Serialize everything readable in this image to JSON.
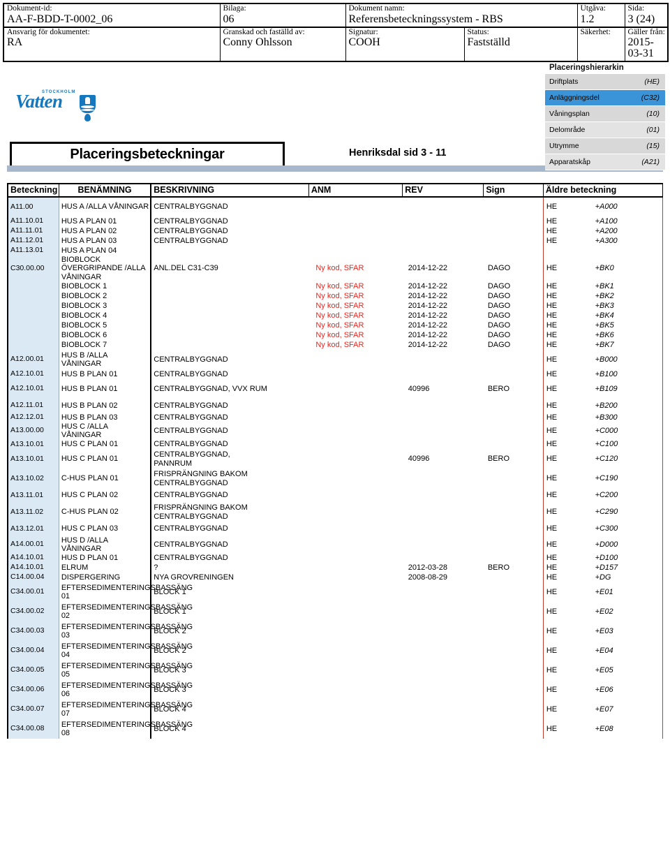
{
  "doc_header": {
    "fields": [
      {
        "label": "Dokument-id:",
        "value": "AA-F-BDD-T-0002_06"
      },
      {
        "label": "Bilaga:",
        "value": "06"
      },
      {
        "label": "Dokument namn:",
        "value": "Referensbeteckningssystem - RBS"
      },
      {
        "label": "Utgåva:",
        "value": "1.2"
      },
      {
        "label": "Sida:",
        "value": "3 (24)"
      },
      {
        "label": "Ansvarig för dokumentet:",
        "value": "RA"
      },
      {
        "label": "Granskad och faställd av:",
        "value": "Conny Ohlsson"
      },
      {
        "label": "Signatur:",
        "value": "COOH"
      },
      {
        "label": "Status:",
        "value": "Fastställd"
      },
      {
        "label": "Säkerhet:",
        "value": ""
      },
      {
        "label": "Gäller från:",
        "value": "2015-03-31"
      }
    ]
  },
  "logo": {
    "top_text": "STOCKHOLM",
    "main_text": "Vatten",
    "brand_color": "#1577bd"
  },
  "title": {
    "box_label": "Placeringsbeteckningar",
    "subtitle": "Henriksdal sid 3 - 11"
  },
  "hierarchy": {
    "title": "Placeringshierarkin",
    "selected_color": "#3c94d8",
    "rows": [
      {
        "name": "Driftplats",
        "code": "(HE)",
        "selected": false
      },
      {
        "name": "Anläggningsdel",
        "code": "(C32)",
        "selected": true
      },
      {
        "name": "Våningsplan",
        "code": "(10)",
        "selected": false
      },
      {
        "name": "Delområde",
        "code": "(01)",
        "selected": false
      },
      {
        "name": "Utrymme",
        "code": "(15)",
        "selected": false
      },
      {
        "name": "Apparatskåp",
        "code": "(A21)",
        "selected": false
      }
    ]
  },
  "table": {
    "accent_color": "#c0392b",
    "beteckning_bg": "#dbe9f4",
    "columns": [
      "Beteckning",
      "BENÄMNING",
      "BESKRIVNING",
      "ANM",
      "REV",
      "Sign",
      "Äldre beteckning"
    ],
    "rows": [
      {
        "bet": "A11.00",
        "ben": "HUS A  /ALLA VÅNINGAR",
        "besk": "CENTRALBYGGNAD",
        "anm": "",
        "rev": "",
        "sign": "",
        "he": "HE",
        "old": "+A000",
        "h": "tall"
      },
      {
        "bet": "A11.10.01",
        "ben": "HUS A PLAN 01",
        "besk": "CENTRALBYGGNAD",
        "anm": "",
        "rev": "",
        "sign": "",
        "he": "HE",
        "old": "+A100",
        "h": ""
      },
      {
        "bet": "A11.11.01",
        "ben": "HUS A PLAN 02",
        "besk": "CENTRALBYGGNAD",
        "anm": "",
        "rev": "",
        "sign": "",
        "he": "HE",
        "old": "+A200",
        "h": ""
      },
      {
        "bet": "A11.12.01",
        "ben": "HUS A PLAN 03",
        "besk": "CENTRALBYGGNAD",
        "anm": "",
        "rev": "",
        "sign": "",
        "he": "HE",
        "old": "+A300",
        "h": ""
      },
      {
        "bet": "A11.13.01",
        "ben": "HUS A PLAN 04",
        "besk": "",
        "anm": "",
        "rev": "",
        "sign": "",
        "he": "",
        "old": "",
        "h": ""
      },
      {
        "bet": "C30.00.00",
        "ben": "BIOBLOCK ÖVERGRIPANDE /ALLA VÅNINGAR",
        "besk": "ANL.DEL C31-C39",
        "anm": "Ny kod, SFAR",
        "rev": "2014-12-22",
        "sign": "DAGO",
        "he": "HE",
        "old": "+BK0",
        "h": "tall"
      },
      {
        "bet": "",
        "ben": "BIOBLOCK 1",
        "besk": "",
        "anm": "Ny kod, SFAR",
        "rev": "2014-12-22",
        "sign": "DAGO",
        "he": "HE",
        "old": "+BK1",
        "h": ""
      },
      {
        "bet": "",
        "ben": "BIOBLOCK 2",
        "besk": "",
        "anm": "Ny kod, SFAR",
        "rev": "2014-12-22",
        "sign": "DAGO",
        "he": "HE",
        "old": "+BK2",
        "h": ""
      },
      {
        "bet": "",
        "ben": "BIOBLOCK 3",
        "besk": "",
        "anm": "Ny kod, SFAR",
        "rev": "2014-12-22",
        "sign": "DAGO",
        "he": "HE",
        "old": "+BK3",
        "h": ""
      },
      {
        "bet": "",
        "ben": "BIOBLOCK 4",
        "besk": "",
        "anm": "Ny kod, SFAR",
        "rev": "2014-12-22",
        "sign": "DAGO",
        "he": "HE",
        "old": "+BK4",
        "h": ""
      },
      {
        "bet": "",
        "ben": "BIOBLOCK 5",
        "besk": "",
        "anm": "Ny kod, SFAR",
        "rev": "2014-12-22",
        "sign": "DAGO",
        "he": "HE",
        "old": "+BK5",
        "h": ""
      },
      {
        "bet": "",
        "ben": "BIOBLOCK 6",
        "besk": "",
        "anm": "Ny kod, SFAR",
        "rev": "2014-12-22",
        "sign": "DAGO",
        "he": "HE",
        "old": "+BK6",
        "h": ""
      },
      {
        "bet": "",
        "ben": "BIOBLOCK 7",
        "besk": "",
        "anm": "Ny kod, SFAR",
        "rev": "2014-12-22",
        "sign": "DAGO",
        "he": "HE",
        "old": "+BK7",
        "h": ""
      },
      {
        "bet": "A12.00.01",
        "ben": "HUS B  /ALLA VÅNINGAR",
        "besk": "CENTRALBYGGNAD",
        "anm": "",
        "rev": "",
        "sign": "",
        "he": "HE",
        "old": "+B000",
        "h": "tall"
      },
      {
        "bet": "A12.10.01",
        "ben": "HUS B PLAN 01",
        "besk": "CENTRALBYGGNAD",
        "anm": "",
        "rev": "",
        "sign": "",
        "he": "HE",
        "old": "+B100",
        "h": ""
      },
      {
        "bet": "A12.10.01",
        "ben": "HUS B PLAN 01",
        "besk": "CENTRALBYGGNAD, VVX RUM",
        "anm": "",
        "rev": "40996",
        "sign": "BERO",
        "he": "HE",
        "old": "+B109",
        "h": "tall"
      },
      {
        "bet": "A12.11.01",
        "ben": "HUS B PLAN 02",
        "besk": "CENTRALBYGGNAD",
        "anm": "",
        "rev": "",
        "sign": "",
        "he": "HE",
        "old": "+B200",
        "h": "gap"
      },
      {
        "bet": "A12.12.01",
        "ben": "HUS B PLAN 03",
        "besk": "CENTRALBYGGNAD",
        "anm": "",
        "rev": "",
        "sign": "",
        "he": "HE",
        "old": "+B300",
        "h": ""
      },
      {
        "bet": "A13.00.00",
        "ben": "HUS C  /ALLA VÅNINGAR",
        "besk": "CENTRALBYGGNAD",
        "anm": "",
        "rev": "",
        "sign": "",
        "he": "HE",
        "old": "+C000",
        "h": ""
      },
      {
        "bet": "A13.10.01",
        "ben": "HUS C PLAN 01",
        "besk": "CENTRALBYGGNAD",
        "anm": "",
        "rev": "",
        "sign": "",
        "he": "HE",
        "old": "+C100",
        "h": ""
      },
      {
        "bet": "A13.10.01",
        "ben": "HUS C PLAN 01",
        "besk": "CENTRALBYGGNAD,\nPANNRUM",
        "anm": "",
        "rev": "40996",
        "sign": "BERO",
        "he": "HE",
        "old": "+C120",
        "h": "tall"
      },
      {
        "bet": "A13.10.02",
        "ben": "C-HUS PLAN 01",
        "besk": "FRISPRÄNGNING BAKOM\nCENTRALBYGGNAD",
        "anm": "",
        "rev": "",
        "sign": "",
        "he": "HE",
        "old": "+C190",
        "h": "tall"
      },
      {
        "bet": "A13.11.01",
        "ben": "HUS C PLAN 02",
        "besk": "CENTRALBYGGNAD",
        "anm": "",
        "rev": "",
        "sign": "",
        "he": "HE",
        "old": "+C200",
        "h": "gap"
      },
      {
        "bet": "A13.11.02",
        "ben": "C-HUS PLAN 02",
        "besk": "FRISPRÄNGNING BAKOM\nCENTRALBYGGNAD",
        "anm": "",
        "rev": "",
        "sign": "",
        "he": "HE",
        "old": "+C290",
        "h": "tall"
      },
      {
        "bet": "A13.12.01",
        "ben": "HUS C PLAN 03",
        "besk": "CENTRALBYGGNAD",
        "anm": "",
        "rev": "",
        "sign": "",
        "he": "HE",
        "old": "+C300",
        "h": "gap"
      },
      {
        "bet": "A14.00.01",
        "ben": "HUS D  /ALLA VÅNINGAR",
        "besk": "CENTRALBYGGNAD",
        "anm": "",
        "rev": "",
        "sign": "",
        "he": "HE",
        "old": "+D000",
        "h": ""
      },
      {
        "bet": "A14.10.01",
        "ben": "HUS D PLAN 01",
        "besk": "CENTRALBYGGNAD",
        "anm": "",
        "rev": "",
        "sign": "",
        "he": "HE",
        "old": "+D100",
        "h": ""
      },
      {
        "bet": "A14.10.01",
        "ben": "ELRUM",
        "besk": "?",
        "anm": "",
        "rev": "2012-03-28",
        "sign": "BERO",
        "he": "HE",
        "old": "+D157",
        "h": ""
      },
      {
        "bet": "C14.00.04",
        "ben": "DISPERGERING",
        "besk": "NYA GROVRENINGEN",
        "anm": "",
        "rev": "2008-08-29",
        "sign": "",
        "he": "HE",
        "old": "+DG",
        "h": ""
      },
      {
        "bet": "C34.00.01",
        "ben": "EFTERSEDIMENTERINGSBASSÄNG 01",
        "besk": "BLOCK 1",
        "anm": "",
        "rev": "",
        "sign": "",
        "he": "HE",
        "old": "+E01",
        "h": "tall"
      },
      {
        "bet": "C34.00.02",
        "ben": "EFTERSEDIMENTERINGSBASSÄNG 02",
        "besk": "BLOCK 1",
        "anm": "",
        "rev": "",
        "sign": "",
        "he": "HE",
        "old": "+E02",
        "h": "tall"
      },
      {
        "bet": "C34.00.03",
        "ben": "EFTERSEDIMENTERINGSBASSÄNG 03",
        "besk": "BLOCK 2",
        "anm": "",
        "rev": "",
        "sign": "",
        "he": "HE",
        "old": "+E03",
        "h": "tall"
      },
      {
        "bet": "C34.00.04",
        "ben": "EFTERSEDIMENTERINGSBASSÄNG 04",
        "besk": "BLOCK 2",
        "anm": "",
        "rev": "",
        "sign": "",
        "he": "HE",
        "old": "+E04",
        "h": "tall"
      },
      {
        "bet": "C34.00.05",
        "ben": "EFTERSEDIMENTERINGSBASSÄNG 05",
        "besk": "BLOCK 3",
        "anm": "",
        "rev": "",
        "sign": "",
        "he": "HE",
        "old": "+E05",
        "h": "tall"
      },
      {
        "bet": "C34.00.06",
        "ben": "EFTERSEDIMENTERINGSBASSÄNG 06",
        "besk": "BLOCK 3",
        "anm": "",
        "rev": "",
        "sign": "",
        "he": "HE",
        "old": "+E06",
        "h": "tall"
      },
      {
        "bet": "C34.00.07",
        "ben": "EFTERSEDIMENTERINGSBASSÄNG 07",
        "besk": "BLOCK 4",
        "anm": "",
        "rev": "",
        "sign": "",
        "he": "HE",
        "old": "+E07",
        "h": "tall"
      },
      {
        "bet": "C34.00.08",
        "ben": "EFTERSEDIMENTERINGSBASSÄNG 08",
        "besk": "BLOCK 4",
        "anm": "",
        "rev": "",
        "sign": "",
        "he": "HE",
        "old": "+E08",
        "h": "tall"
      }
    ]
  }
}
